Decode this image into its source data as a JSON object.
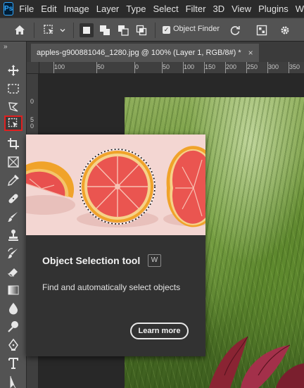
{
  "app": {
    "logo": "Ps",
    "menu": [
      "File",
      "Edit",
      "Image",
      "Layer",
      "Type",
      "Select",
      "Filter",
      "3D",
      "View",
      "Plugins",
      "Win"
    ]
  },
  "options_bar": {
    "object_finder_checked": true,
    "object_finder_label": "Object Finder"
  },
  "toolbar": {
    "collapse_glyph": "»",
    "tools": [
      "move-icon",
      "marquee-icon",
      "lasso-icon",
      "object-selection-icon",
      "crop-icon",
      "frame-icon",
      "eyedropper-icon",
      "healing-brush-icon",
      "brush-icon",
      "clone-stamp-icon",
      "history-brush-icon",
      "eraser-icon",
      "gradient-icon",
      "blur-icon",
      "dodge-icon",
      "pen-icon",
      "type-icon",
      "path-selection-icon"
    ],
    "selected_tool": "object-selection-icon"
  },
  "document": {
    "tab_title": "apples-g900881046_1280.jpg @ 100% (Layer 1, RGB/8#) *",
    "close_glyph": "×"
  },
  "ruler": {
    "h_labels": [
      "100",
      "50",
      "0",
      "50",
      "100",
      "150",
      "200",
      "250",
      "300",
      "350"
    ],
    "v_labels": [
      "0",
      "5",
      "0",
      "5",
      "0"
    ]
  },
  "tooltip": {
    "title": "Object Selection tool",
    "shortcut": "W",
    "description": "Find and automatically select objects",
    "button": "Learn more"
  },
  "colors": {
    "accent_selected_border": "#e02020",
    "panel": "#535353",
    "tooltip_bg": "#323232"
  }
}
